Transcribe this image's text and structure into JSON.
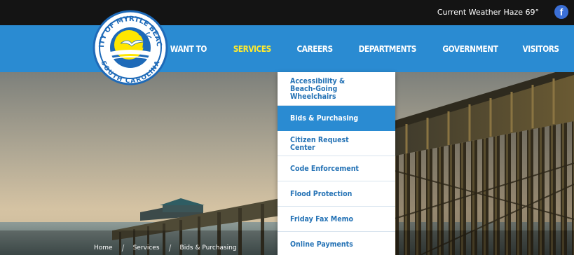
{
  "topbar": {
    "weather": "Current Weather  Haze 69°",
    "facebook_label": "f"
  },
  "logo": {
    "top_text": "CITY OF MYRTLE BEACH",
    "bottom_text": "SOUTH CAROLINA"
  },
  "nav": {
    "items": [
      {
        "label": "I WANT TO"
      },
      {
        "label": "SERVICES"
      },
      {
        "label": "CAREERS"
      },
      {
        "label": "DEPARTMENTS"
      },
      {
        "label": "GOVERNMENT"
      },
      {
        "label": "VISITORS"
      }
    ],
    "active_index": 1
  },
  "dropdown": {
    "items": [
      {
        "label": "Accessibility & Beach-Going Wheelchairs"
      },
      {
        "label": "Bids & Purchasing"
      },
      {
        "label": "Citizen Request Center"
      },
      {
        "label": "Code Enforcement"
      },
      {
        "label": "Flood Protection"
      },
      {
        "label": "Friday Fax Memo"
      },
      {
        "label": "Online Payments"
      }
    ],
    "selected_index": 1
  },
  "breadcrumb": {
    "items": [
      "Home",
      "Services",
      "Bids & Purchasing"
    ]
  },
  "colors": {
    "nav_bg": "#2a8bd2",
    "nav_active": "#ffeb2e",
    "dropdown_text": "#2472b5",
    "topbar_bg": "#141414"
  }
}
